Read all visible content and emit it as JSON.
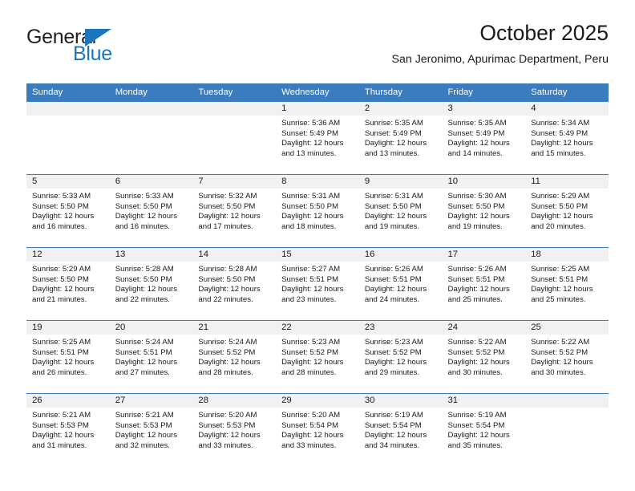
{
  "brand": {
    "word_one": "General",
    "word_two": "Blue",
    "triangle_icon": "triangle-icon",
    "color_blue": "#1c74bb",
    "color_dark": "#231f20"
  },
  "header": {
    "title": "October 2025",
    "subtitle": "San Jeronimo, Apurimac Department, Peru"
  },
  "calendar": {
    "header_bg": "#3b7cbf",
    "daynum_bg": "#f1f1f1",
    "weekdays": [
      "Sunday",
      "Monday",
      "Tuesday",
      "Wednesday",
      "Thursday",
      "Friday",
      "Saturday"
    ],
    "weeks": [
      [
        {
          "day": "",
          "lines": []
        },
        {
          "day": "",
          "lines": []
        },
        {
          "day": "",
          "lines": []
        },
        {
          "day": "1",
          "lines": [
            "Sunrise: 5:36 AM",
            "Sunset: 5:49 PM",
            "Daylight: 12 hours",
            "and 13 minutes."
          ]
        },
        {
          "day": "2",
          "lines": [
            "Sunrise: 5:35 AM",
            "Sunset: 5:49 PM",
            "Daylight: 12 hours",
            "and 13 minutes."
          ]
        },
        {
          "day": "3",
          "lines": [
            "Sunrise: 5:35 AM",
            "Sunset: 5:49 PM",
            "Daylight: 12 hours",
            "and 14 minutes."
          ]
        },
        {
          "day": "4",
          "lines": [
            "Sunrise: 5:34 AM",
            "Sunset: 5:49 PM",
            "Daylight: 12 hours",
            "and 15 minutes."
          ]
        }
      ],
      [
        {
          "day": "5",
          "lines": [
            "Sunrise: 5:33 AM",
            "Sunset: 5:50 PM",
            "Daylight: 12 hours",
            "and 16 minutes."
          ]
        },
        {
          "day": "6",
          "lines": [
            "Sunrise: 5:33 AM",
            "Sunset: 5:50 PM",
            "Daylight: 12 hours",
            "and 16 minutes."
          ]
        },
        {
          "day": "7",
          "lines": [
            "Sunrise: 5:32 AM",
            "Sunset: 5:50 PM",
            "Daylight: 12 hours",
            "and 17 minutes."
          ]
        },
        {
          "day": "8",
          "lines": [
            "Sunrise: 5:31 AM",
            "Sunset: 5:50 PM",
            "Daylight: 12 hours",
            "and 18 minutes."
          ]
        },
        {
          "day": "9",
          "lines": [
            "Sunrise: 5:31 AM",
            "Sunset: 5:50 PM",
            "Daylight: 12 hours",
            "and 19 minutes."
          ]
        },
        {
          "day": "10",
          "lines": [
            "Sunrise: 5:30 AM",
            "Sunset: 5:50 PM",
            "Daylight: 12 hours",
            "and 19 minutes."
          ]
        },
        {
          "day": "11",
          "lines": [
            "Sunrise: 5:29 AM",
            "Sunset: 5:50 PM",
            "Daylight: 12 hours",
            "and 20 minutes."
          ]
        }
      ],
      [
        {
          "day": "12",
          "lines": [
            "Sunrise: 5:29 AM",
            "Sunset: 5:50 PM",
            "Daylight: 12 hours",
            "and 21 minutes."
          ]
        },
        {
          "day": "13",
          "lines": [
            "Sunrise: 5:28 AM",
            "Sunset: 5:50 PM",
            "Daylight: 12 hours",
            "and 22 minutes."
          ]
        },
        {
          "day": "14",
          "lines": [
            "Sunrise: 5:28 AM",
            "Sunset: 5:50 PM",
            "Daylight: 12 hours",
            "and 22 minutes."
          ]
        },
        {
          "day": "15",
          "lines": [
            "Sunrise: 5:27 AM",
            "Sunset: 5:51 PM",
            "Daylight: 12 hours",
            "and 23 minutes."
          ]
        },
        {
          "day": "16",
          "lines": [
            "Sunrise: 5:26 AM",
            "Sunset: 5:51 PM",
            "Daylight: 12 hours",
            "and 24 minutes."
          ]
        },
        {
          "day": "17",
          "lines": [
            "Sunrise: 5:26 AM",
            "Sunset: 5:51 PM",
            "Daylight: 12 hours",
            "and 25 minutes."
          ]
        },
        {
          "day": "18",
          "lines": [
            "Sunrise: 5:25 AM",
            "Sunset: 5:51 PM",
            "Daylight: 12 hours",
            "and 25 minutes."
          ]
        }
      ],
      [
        {
          "day": "19",
          "lines": [
            "Sunrise: 5:25 AM",
            "Sunset: 5:51 PM",
            "Daylight: 12 hours",
            "and 26 minutes."
          ]
        },
        {
          "day": "20",
          "lines": [
            "Sunrise: 5:24 AM",
            "Sunset: 5:51 PM",
            "Daylight: 12 hours",
            "and 27 minutes."
          ]
        },
        {
          "day": "21",
          "lines": [
            "Sunrise: 5:24 AM",
            "Sunset: 5:52 PM",
            "Daylight: 12 hours",
            "and 28 minutes."
          ]
        },
        {
          "day": "22",
          "lines": [
            "Sunrise: 5:23 AM",
            "Sunset: 5:52 PM",
            "Daylight: 12 hours",
            "and 28 minutes."
          ]
        },
        {
          "day": "23",
          "lines": [
            "Sunrise: 5:23 AM",
            "Sunset: 5:52 PM",
            "Daylight: 12 hours",
            "and 29 minutes."
          ]
        },
        {
          "day": "24",
          "lines": [
            "Sunrise: 5:22 AM",
            "Sunset: 5:52 PM",
            "Daylight: 12 hours",
            "and 30 minutes."
          ]
        },
        {
          "day": "25",
          "lines": [
            "Sunrise: 5:22 AM",
            "Sunset: 5:52 PM",
            "Daylight: 12 hours",
            "and 30 minutes."
          ]
        }
      ],
      [
        {
          "day": "26",
          "lines": [
            "Sunrise: 5:21 AM",
            "Sunset: 5:53 PM",
            "Daylight: 12 hours",
            "and 31 minutes."
          ]
        },
        {
          "day": "27",
          "lines": [
            "Sunrise: 5:21 AM",
            "Sunset: 5:53 PM",
            "Daylight: 12 hours",
            "and 32 minutes."
          ]
        },
        {
          "day": "28",
          "lines": [
            "Sunrise: 5:20 AM",
            "Sunset: 5:53 PM",
            "Daylight: 12 hours",
            "and 33 minutes."
          ]
        },
        {
          "day": "29",
          "lines": [
            "Sunrise: 5:20 AM",
            "Sunset: 5:54 PM",
            "Daylight: 12 hours",
            "and 33 minutes."
          ]
        },
        {
          "day": "30",
          "lines": [
            "Sunrise: 5:19 AM",
            "Sunset: 5:54 PM",
            "Daylight: 12 hours",
            "and 34 minutes."
          ]
        },
        {
          "day": "31",
          "lines": [
            "Sunrise: 5:19 AM",
            "Sunset: 5:54 PM",
            "Daylight: 12 hours",
            "and 35 minutes."
          ]
        },
        {
          "day": "",
          "lines": []
        }
      ]
    ]
  }
}
